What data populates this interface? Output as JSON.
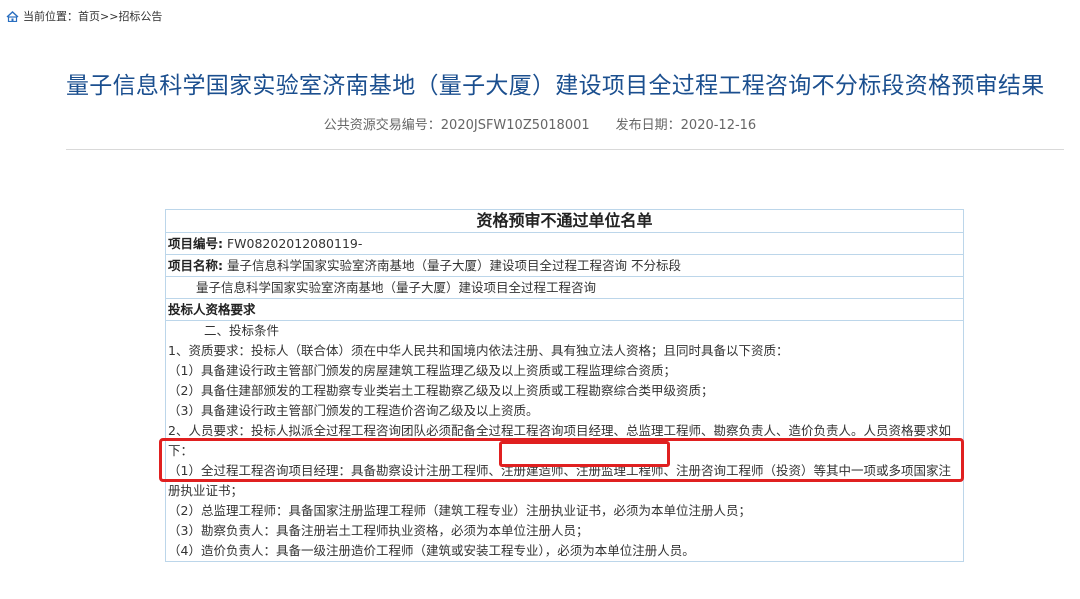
{
  "breadcrumb": {
    "prefix": "当前位置：",
    "home": "首页",
    "separator": " >>",
    "current": "招标公告"
  },
  "title": "量子信息科学国家实验室济南基地（量子大厦）建设项目全过程工程咨询不分标段资格预审结果",
  "meta": {
    "trade_no_label": "公共资源交易编号：",
    "trade_no": "2020JSFW10Z5018001",
    "date_label": "发布日期：",
    "date": "2020-12-16"
  },
  "doc": {
    "heading": "资格预审不通过单位名单",
    "project_no_label": "项目编号:",
    "project_no": " FW08202012080119-",
    "project_name_label": "项目名称:",
    "project_name": " 量子信息科学国家实验室济南基地（量子大厦）建设项目全过程工程咨询 不分标段",
    "project_name_2": "量子信息科学国家实验室济南基地（量子大厦）建设项目全过程工程咨询",
    "req_heading": "投标人资格要求",
    "section_two": "二、投标条件",
    "item1": "1、资质要求：投标人（联合体）须在中华人民共和国境内依法注册、具有独立法人资格；且同时具备以下资质：",
    "item1_1": "（1）具备建设行政主管部门颁发的房屋建筑工程监理乙级及以上资质或工程监理综合资质；",
    "item1_2": "（2）具备住建部颁发的工程勘察专业类岩土工程勘察乙级及以上资质或工程勘察综合类甲级资质；",
    "item1_3": "（3）具备建设行政主管部门颁发的工程造价咨询乙级及以上资质。",
    "item2": "2、人员要求：投标人拟派全过程工程咨询团队必须配备全过程工程咨询项目经理、总监理工程师、勘察负责人、造价负责人。人员资格要求如下：",
    "item2_1": "（1）全过程工程咨询项目经理：具备勘察设计注册工程师、注册建造师、注册监理工程师、注册咨询工程师（投资）等其中一项或多项国家注册执业证书；",
    "item2_2": "（2）总监理工程师：具备国家注册监理工程师（建筑工程专业）注册执业证书，必须为本单位注册人员；",
    "item2_3": "（3）勘察负责人：具备注册岩土工程师执业资格，必须为本单位注册人员；",
    "item2_4": "（4）造价负责人：具备一级注册造价工程师（建筑或安装工程专业），必须为本单位注册人员。"
  },
  "colors": {
    "title": "#1b4f8f",
    "table_border": "#bcd6ea",
    "highlight": "#e02020"
  }
}
